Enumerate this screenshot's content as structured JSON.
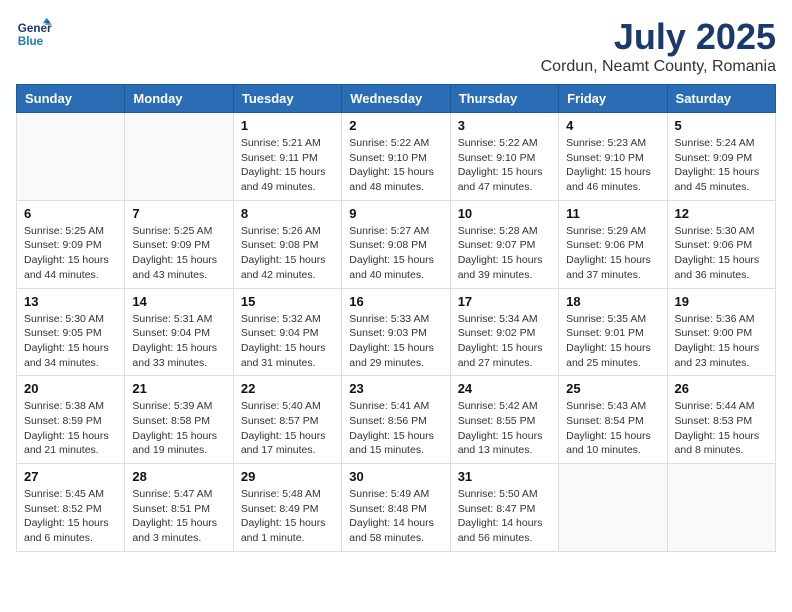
{
  "logo": {
    "line1": "General",
    "line2": "Blue"
  },
  "title": "July 2025",
  "subtitle": "Cordun, Neamt County, Romania",
  "weekdays": [
    "Sunday",
    "Monday",
    "Tuesday",
    "Wednesday",
    "Thursday",
    "Friday",
    "Saturday"
  ],
  "weeks": [
    [
      {
        "day": "",
        "info": ""
      },
      {
        "day": "",
        "info": ""
      },
      {
        "day": "1",
        "info": "Sunrise: 5:21 AM\nSunset: 9:11 PM\nDaylight: 15 hours\nand 49 minutes."
      },
      {
        "day": "2",
        "info": "Sunrise: 5:22 AM\nSunset: 9:10 PM\nDaylight: 15 hours\nand 48 minutes."
      },
      {
        "day": "3",
        "info": "Sunrise: 5:22 AM\nSunset: 9:10 PM\nDaylight: 15 hours\nand 47 minutes."
      },
      {
        "day": "4",
        "info": "Sunrise: 5:23 AM\nSunset: 9:10 PM\nDaylight: 15 hours\nand 46 minutes."
      },
      {
        "day": "5",
        "info": "Sunrise: 5:24 AM\nSunset: 9:09 PM\nDaylight: 15 hours\nand 45 minutes."
      }
    ],
    [
      {
        "day": "6",
        "info": "Sunrise: 5:25 AM\nSunset: 9:09 PM\nDaylight: 15 hours\nand 44 minutes."
      },
      {
        "day": "7",
        "info": "Sunrise: 5:25 AM\nSunset: 9:09 PM\nDaylight: 15 hours\nand 43 minutes."
      },
      {
        "day": "8",
        "info": "Sunrise: 5:26 AM\nSunset: 9:08 PM\nDaylight: 15 hours\nand 42 minutes."
      },
      {
        "day": "9",
        "info": "Sunrise: 5:27 AM\nSunset: 9:08 PM\nDaylight: 15 hours\nand 40 minutes."
      },
      {
        "day": "10",
        "info": "Sunrise: 5:28 AM\nSunset: 9:07 PM\nDaylight: 15 hours\nand 39 minutes."
      },
      {
        "day": "11",
        "info": "Sunrise: 5:29 AM\nSunset: 9:06 PM\nDaylight: 15 hours\nand 37 minutes."
      },
      {
        "day": "12",
        "info": "Sunrise: 5:30 AM\nSunset: 9:06 PM\nDaylight: 15 hours\nand 36 minutes."
      }
    ],
    [
      {
        "day": "13",
        "info": "Sunrise: 5:30 AM\nSunset: 9:05 PM\nDaylight: 15 hours\nand 34 minutes."
      },
      {
        "day": "14",
        "info": "Sunrise: 5:31 AM\nSunset: 9:04 PM\nDaylight: 15 hours\nand 33 minutes."
      },
      {
        "day": "15",
        "info": "Sunrise: 5:32 AM\nSunset: 9:04 PM\nDaylight: 15 hours\nand 31 minutes."
      },
      {
        "day": "16",
        "info": "Sunrise: 5:33 AM\nSunset: 9:03 PM\nDaylight: 15 hours\nand 29 minutes."
      },
      {
        "day": "17",
        "info": "Sunrise: 5:34 AM\nSunset: 9:02 PM\nDaylight: 15 hours\nand 27 minutes."
      },
      {
        "day": "18",
        "info": "Sunrise: 5:35 AM\nSunset: 9:01 PM\nDaylight: 15 hours\nand 25 minutes."
      },
      {
        "day": "19",
        "info": "Sunrise: 5:36 AM\nSunset: 9:00 PM\nDaylight: 15 hours\nand 23 minutes."
      }
    ],
    [
      {
        "day": "20",
        "info": "Sunrise: 5:38 AM\nSunset: 8:59 PM\nDaylight: 15 hours\nand 21 minutes."
      },
      {
        "day": "21",
        "info": "Sunrise: 5:39 AM\nSunset: 8:58 PM\nDaylight: 15 hours\nand 19 minutes."
      },
      {
        "day": "22",
        "info": "Sunrise: 5:40 AM\nSunset: 8:57 PM\nDaylight: 15 hours\nand 17 minutes."
      },
      {
        "day": "23",
        "info": "Sunrise: 5:41 AM\nSunset: 8:56 PM\nDaylight: 15 hours\nand 15 minutes."
      },
      {
        "day": "24",
        "info": "Sunrise: 5:42 AM\nSunset: 8:55 PM\nDaylight: 15 hours\nand 13 minutes."
      },
      {
        "day": "25",
        "info": "Sunrise: 5:43 AM\nSunset: 8:54 PM\nDaylight: 15 hours\nand 10 minutes."
      },
      {
        "day": "26",
        "info": "Sunrise: 5:44 AM\nSunset: 8:53 PM\nDaylight: 15 hours\nand 8 minutes."
      }
    ],
    [
      {
        "day": "27",
        "info": "Sunrise: 5:45 AM\nSunset: 8:52 PM\nDaylight: 15 hours\nand 6 minutes."
      },
      {
        "day": "28",
        "info": "Sunrise: 5:47 AM\nSunset: 8:51 PM\nDaylight: 15 hours\nand 3 minutes."
      },
      {
        "day": "29",
        "info": "Sunrise: 5:48 AM\nSunset: 8:49 PM\nDaylight: 15 hours\nand 1 minute."
      },
      {
        "day": "30",
        "info": "Sunrise: 5:49 AM\nSunset: 8:48 PM\nDaylight: 14 hours\nand 58 minutes."
      },
      {
        "day": "31",
        "info": "Sunrise: 5:50 AM\nSunset: 8:47 PM\nDaylight: 14 hours\nand 56 minutes."
      },
      {
        "day": "",
        "info": ""
      },
      {
        "day": "",
        "info": ""
      }
    ]
  ]
}
